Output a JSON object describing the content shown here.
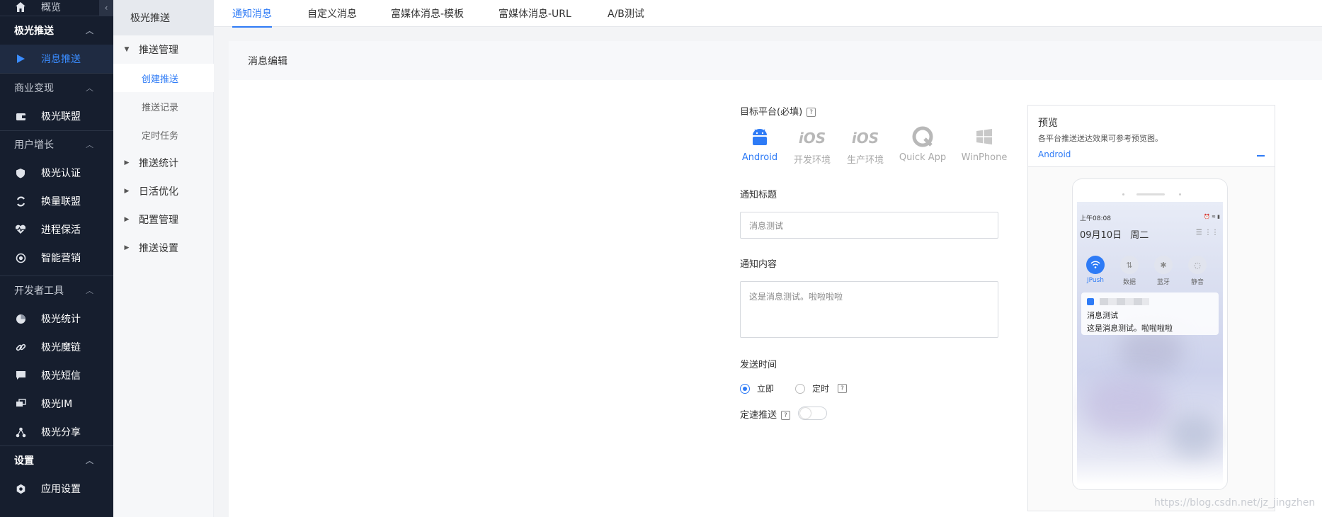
{
  "sidebar": {
    "top_item": "概览",
    "groups": [
      {
        "label": "极光推送",
        "items": [
          {
            "label": "消息推送",
            "icon": "play-icon",
            "active": true
          }
        ]
      },
      {
        "label": "商业变现",
        "items": [
          {
            "label": "极光联盟",
            "icon": "wallet-icon"
          }
        ]
      },
      {
        "label": "用户增长",
        "items": [
          {
            "label": "极光认证",
            "icon": "shield-icon"
          },
          {
            "label": "换量联盟",
            "icon": "swap-icon"
          },
          {
            "label": "进程保活",
            "icon": "heart-icon"
          },
          {
            "label": "智能营销",
            "icon": "target-icon"
          }
        ]
      },
      {
        "label": "开发者工具",
        "items": [
          {
            "label": "极光统计",
            "icon": "pie-icon"
          },
          {
            "label": "极光魔链",
            "icon": "link-icon"
          },
          {
            "label": "极光短信",
            "icon": "message-icon"
          },
          {
            "label": "极光IM",
            "icon": "chat-icon"
          },
          {
            "label": "极光分享",
            "icon": "share-icon"
          }
        ]
      },
      {
        "label": "设置",
        "items": [
          {
            "label": "应用设置",
            "icon": "gear-icon"
          }
        ]
      }
    ]
  },
  "subnav": {
    "title": "极光推送",
    "sections": [
      {
        "label": "推送管理",
        "expanded": true,
        "children": [
          "创建推送",
          "推送记录",
          "定时任务"
        ]
      },
      {
        "label": "推送统计"
      },
      {
        "label": "日活优化"
      },
      {
        "label": "配置管理"
      },
      {
        "label": "推送设置"
      }
    ]
  },
  "tabs": [
    "通知消息",
    "自定义消息",
    "富媒体消息-模板",
    "富媒体消息-URL",
    "A/B测试"
  ],
  "panel": {
    "title": "消息编辑",
    "target_platform_label": "目标平台(必填)",
    "platforms": [
      {
        "label": "Android",
        "active": true
      },
      {
        "label": "开发环境",
        "mark": "iOS"
      },
      {
        "label": "生产环境",
        "mark": "iOS"
      },
      {
        "label": "Quick App"
      },
      {
        "label": "WinPhone"
      }
    ],
    "title_label": "通知标题",
    "title_value": "消息测试",
    "content_label": "通知内容",
    "content_value": "这是消息测试。啦啦啦啦",
    "send_time_label": "发送时间",
    "send_now": "立即",
    "send_scheduled": "定时",
    "rate_label": "定速推送"
  },
  "preview": {
    "title": "预览",
    "description": "各平台推送送达效果可参考预览图。",
    "platform": "Android",
    "time": "上午08:08",
    "date": "09月10日",
    "weekday": "周二",
    "toggles": [
      "JPush",
      "数据",
      "蓝牙",
      "静音"
    ],
    "notif_title": "消息测试",
    "notif_body": "这是消息测试。啦啦啦啦"
  },
  "watermark": "https://blog.csdn.net/jz_jingzhen",
  "colors": {
    "accent": "#2e7bf6",
    "sidebar_bg": "#161e2e"
  }
}
